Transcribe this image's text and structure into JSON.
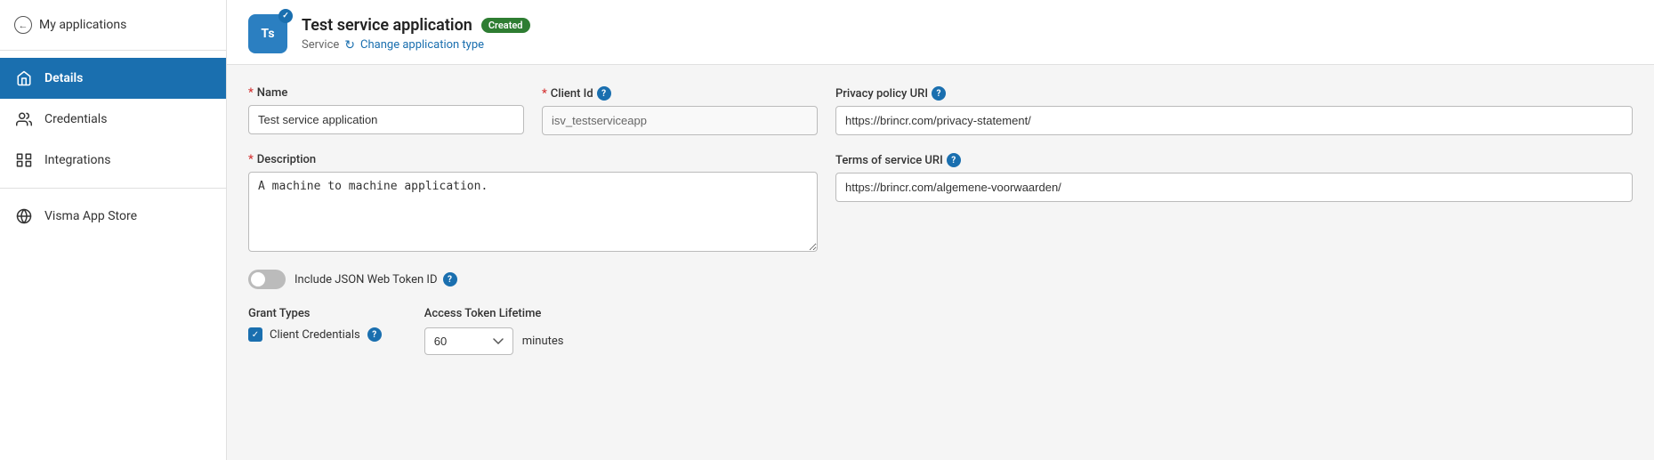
{
  "sidebar": {
    "back_label": "My applications",
    "items": [
      {
        "id": "details",
        "label": "Details",
        "active": true,
        "icon": "home-icon"
      },
      {
        "id": "credentials",
        "label": "Credentials",
        "active": false,
        "icon": "credentials-icon"
      },
      {
        "id": "integrations",
        "label": "Integrations",
        "active": false,
        "icon": "integrations-icon"
      },
      {
        "id": "visma-app-store",
        "label": "Visma App Store",
        "active": false,
        "icon": "store-icon"
      }
    ]
  },
  "header": {
    "avatar_text": "Ts",
    "app_title": "Test service application",
    "status_badge": "Created",
    "app_type": "Service",
    "change_type_label": "Change application type"
  },
  "form": {
    "name_label": "*Name",
    "name_required": "*",
    "name_value": "Test service application",
    "client_id_label": "Client Id",
    "client_id_required": "*",
    "client_id_value": "isv_testserviceapp",
    "privacy_policy_label": "Privacy policy URI",
    "privacy_policy_value": "https://brincr.com/privacy-statement/",
    "description_label": "*Description",
    "description_required": "*",
    "description_value": "A machine to machine application.",
    "terms_of_service_label": "Terms of service URI",
    "terms_of_service_value": "https://brincr.com/algemene-voorwaarden/",
    "jwt_toggle_label": "Include JSON Web Token ID",
    "jwt_toggle_state": "off",
    "grant_types_label": "Grant Types",
    "client_credentials_label": "Client Credentials",
    "access_token_label": "Access Token Lifetime",
    "access_token_value": "60",
    "minutes_label": "minutes"
  }
}
